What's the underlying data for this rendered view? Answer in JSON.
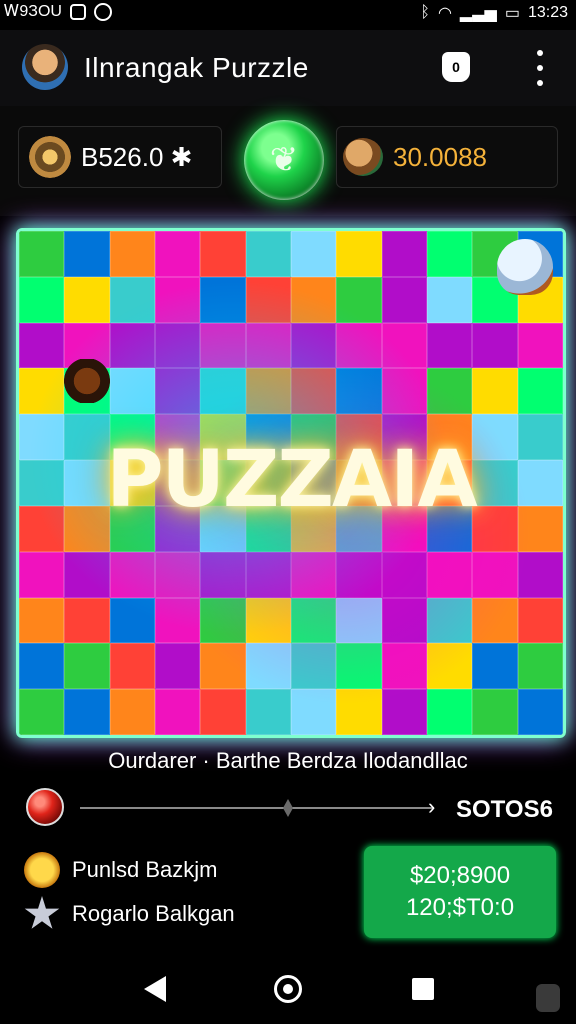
{
  "status_bar": {
    "left_text": "Ꮃ9ЗOU",
    "time": "13:23"
  },
  "app_bar": {
    "title": "Ilnrangak Purzzle",
    "badge": "0"
  },
  "stats": {
    "left_value": "B526.0 ✱",
    "right_value": "30.0088"
  },
  "board": {
    "word": "PUZZAIA",
    "palette": [
      "#2ecc40",
      "#ffdc00",
      "#ff4136",
      "#0074d9",
      "#b10dc9",
      "#39cccc",
      "#ff851b",
      "#01ff70",
      "#7fdbff",
      "#f012be"
    ]
  },
  "subtitle": "Ourdarer · Barthe Berdza Ilodandllac",
  "slider": {
    "value_label": "SOTOS6",
    "arrow": "›"
  },
  "leaders": [
    {
      "label": "Punlsd Bazkjm",
      "icon": "sun-icon"
    },
    {
      "label": "Rogarlo Balkgan",
      "icon": "star-icon"
    }
  ],
  "cta": {
    "line1": "$20;8900",
    "line2": "120;$T0:0"
  }
}
